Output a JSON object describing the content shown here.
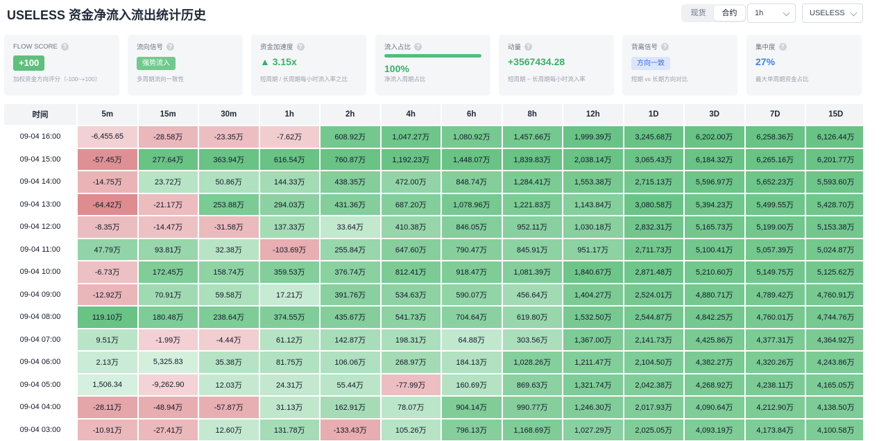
{
  "header": {
    "title": "USELESS 资金净流入流出统计历史",
    "market_tabs": [
      "现货",
      "合约"
    ],
    "active_market": "合约",
    "interval": "1h",
    "symbol": "USELESS"
  },
  "cards": [
    {
      "label": "FLOW SCORE",
      "value": "+100",
      "sub": "加权资金方向评分（-100~+100）"
    },
    {
      "label": "流向信号",
      "value": "强势流入",
      "sub": "多周期流向一致性"
    },
    {
      "label": "资金加速度",
      "value": "▲ 3.15x",
      "sub": "短周期 / 长周期每小时流入率之比"
    },
    {
      "label": "流入占比",
      "value": "100%",
      "sub": "净流入周期占比",
      "progress": 1.0
    },
    {
      "label": "动量",
      "value": "+3567434.28",
      "sub": "短周期 − 长周期每小时流入率"
    },
    {
      "label": "背离信号",
      "value": "方向一致",
      "sub": "短期 vs 长期方向对比"
    },
    {
      "label": "集中度",
      "value": "27%",
      "sub": "最大单周期资金占比"
    }
  ],
  "colors": {
    "positive": "#5fbf7d",
    "negative": "#d46a6f",
    "accent_blue": "#3b82f6"
  },
  "table": {
    "headers": [
      "时间",
      "5m",
      "15m",
      "30m",
      "1h",
      "2h",
      "4h",
      "6h",
      "8h",
      "12h",
      "1D",
      "3D",
      "7D",
      "15D"
    ],
    "rows": [
      [
        "09-04 16:00",
        "-6,455.65",
        "-28.58万",
        "-23.35万",
        "-7.62万",
        "608.92万",
        "1,047.27万",
        "1,080.92万",
        "1,457.66万",
        "1,999.39万",
        "3,245.68万",
        "6,202.00万",
        "6,258.36万",
        "6,126.44万"
      ],
      [
        "09-04 15:00",
        "-57.45万",
        "277.64万",
        "363.94万",
        "616.54万",
        "760.87万",
        "1,192.23万",
        "1,448.07万",
        "1,839.83万",
        "2,038.14万",
        "3,065.43万",
        "6,184.32万",
        "6,265.16万",
        "6,201.77万"
      ],
      [
        "09-04 14:00",
        "-14.75万",
        "23.72万",
        "50.86万",
        "144.33万",
        "438.35万",
        "472.00万",
        "848.74万",
        "1,284.41万",
        "1,553.38万",
        "2,715.13万",
        "5,596.97万",
        "5,652.23万",
        "5,593.60万"
      ],
      [
        "09-04 13:00",
        "-64.42万",
        "-21.17万",
        "253.88万",
        "294.03万",
        "431.36万",
        "687.20万",
        "1,078.96万",
        "1,221.83万",
        "1,143.84万",
        "3,080.58万",
        "5,394.23万",
        "5,499.55万",
        "5,428.70万"
      ],
      [
        "09-04 12:00",
        "-8.35万",
        "-14.47万",
        "-31.58万",
        "137.33万",
        "33.64万",
        "410.38万",
        "846.05万",
        "952.11万",
        "1,030.18万",
        "2,832.31万",
        "5,165.73万",
        "5,199.00万",
        "5,153.38万"
      ],
      [
        "09-04 11:00",
        "47.79万",
        "93.81万",
        "32.38万",
        "-103.69万",
        "255.84万",
        "647.60万",
        "790.47万",
        "845.91万",
        "951.17万",
        "2,711.73万",
        "5,100.41万",
        "5,057.39万",
        "5,024.87万"
      ],
      [
        "09-04 10:00",
        "-6.73万",
        "172.45万",
        "158.74万",
        "359.53万",
        "376.74万",
        "812.41万",
        "918.47万",
        "1,081.39万",
        "1,840.67万",
        "2,871.48万",
        "5,210.60万",
        "5,149.75万",
        "5,125.62万"
      ],
      [
        "09-04 09:00",
        "-12.92万",
        "70.91万",
        "59.58万",
        "17.21万",
        "391.76万",
        "534.63万",
        "590.07万",
        "456.64万",
        "1,404.27万",
        "2,524.01万",
        "4,880.71万",
        "4,789.42万",
        "4,760.91万"
      ],
      [
        "09-04 08:00",
        "119.10万",
        "180.48万",
        "238.64万",
        "374.55万",
        "435.67万",
        "541.73万",
        "704.64万",
        "619.80万",
        "1,532.50万",
        "2,544.87万",
        "4,842.25万",
        "4,760.01万",
        "4,744.76万"
      ],
      [
        "09-04 07:00",
        "9.51万",
        "-1.99万",
        "-4.44万",
        "61.12万",
        "142.87万",
        "198.31万",
        "64.88万",
        "303.56万",
        "1,367.00万",
        "2,141.73万",
        "4,425.86万",
        "4,377.31万",
        "4,364.92万"
      ],
      [
        "09-04 06:00",
        "2.13万",
        "5,325.83",
        "35.38万",
        "81.75万",
        "106.06万",
        "268.97万",
        "184.13万",
        "1,028.26万",
        "1,211.47万",
        "2,104.50万",
        "4,382.27万",
        "4,320.26万",
        "4,243.86万"
      ],
      [
        "09-04 05:00",
        "1,506.34",
        "-9,262.90",
        "12.03万",
        "24.31万",
        "55.44万",
        "-77.99万",
        "160.69万",
        "869.63万",
        "1,321.74万",
        "2,042.38万",
        "4,268.92万",
        "4,238.11万",
        "4,165.05万"
      ],
      [
        "09-04 04:00",
        "-28.11万",
        "-48.94万",
        "-57.87万",
        "31.13万",
        "162.91万",
        "78.07万",
        "904.14万",
        "990.77万",
        "1,246.30万",
        "2,017.93万",
        "4,090.64万",
        "4,212.90万",
        "4,138.50万"
      ],
      [
        "09-04 03:00",
        "-10.91万",
        "-27.41万",
        "12.60万",
        "131.78万",
        "-133.43万",
        "105.26万",
        "796.13万",
        "1,168.69万",
        "1,027.29万",
        "2,025.05万",
        "4,093.19万",
        "4,173.84万",
        "4,100.58万"
      ]
    ]
  }
}
